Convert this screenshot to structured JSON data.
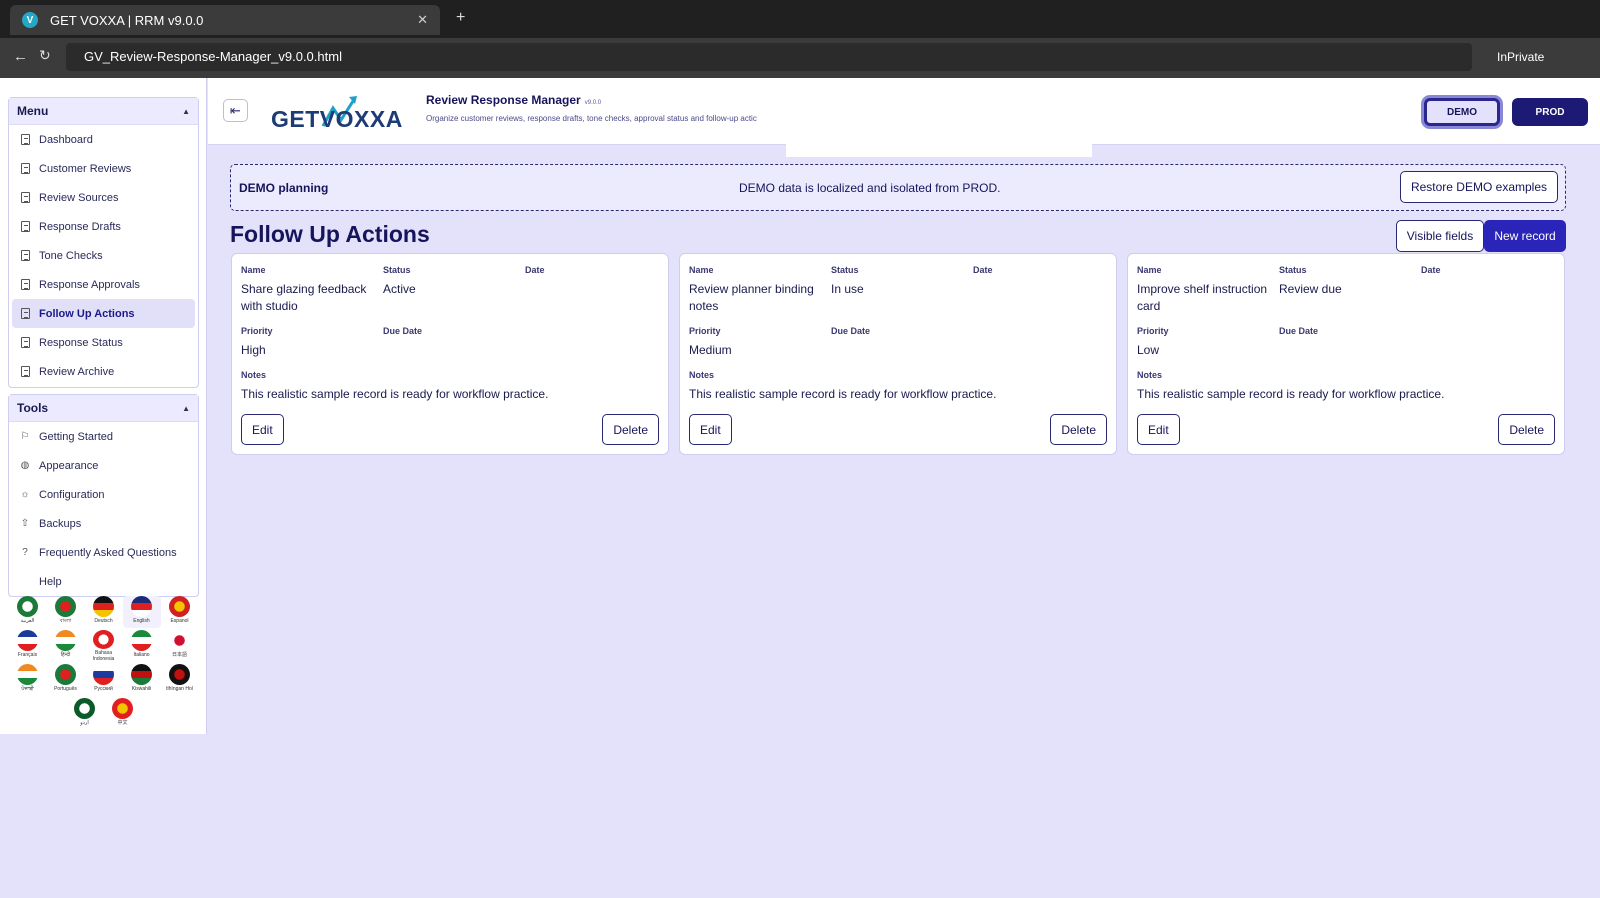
{
  "browser": {
    "tab_title": "GET VOXXA | RRM v9.0.0",
    "favicon_letter": "V",
    "url": "GV_Review-Response-Manager_v9.0.0.html",
    "inprivate": "InPrivate"
  },
  "sidebar": {
    "menu_title": "Menu",
    "menu_items": [
      {
        "label": "Dashboard"
      },
      {
        "label": "Customer Reviews"
      },
      {
        "label": "Review Sources"
      },
      {
        "label": "Response Drafts"
      },
      {
        "label": "Tone Checks"
      },
      {
        "label": "Response Approvals"
      },
      {
        "label": "Follow Up Actions",
        "active": true
      },
      {
        "label": "Response Status"
      },
      {
        "label": "Review Archive"
      }
    ],
    "tools_title": "Tools",
    "tools_items": [
      {
        "label": "Getting Started",
        "icon": "flag-icon"
      },
      {
        "label": "Appearance",
        "icon": "palette-icon"
      },
      {
        "label": "Configuration",
        "icon": "gear-icon"
      },
      {
        "label": "Backups",
        "icon": "upload-icon"
      },
      {
        "label": "Frequently Asked Questions",
        "icon": "question-icon"
      },
      {
        "label": "Help",
        "icon": ""
      }
    ],
    "languages": [
      {
        "name": "العربية",
        "colors": [
          "#1a7a3a",
          "#ffffff"
        ]
      },
      {
        "name": "বাংলা",
        "colors": [
          "#1a7a3a",
          "#e02020"
        ]
      },
      {
        "name": "Deutsch",
        "colors": [
          "#111111",
          "#e02020",
          "#f5c400"
        ]
      },
      {
        "name": "English",
        "colors": [
          "#1c2a78",
          "#e02020",
          "#ffffff"
        ],
        "selected": true
      },
      {
        "name": "Espanol",
        "colors": [
          "#d22020",
          "#f5c400"
        ]
      },
      {
        "name": "Français",
        "colors": [
          "#1c3a9a",
          "#ffffff",
          "#e02020"
        ]
      },
      {
        "name": "हिन्दी",
        "colors": [
          "#f08a20",
          "#ffffff",
          "#1a8a3a"
        ]
      },
      {
        "name": "Bahasa Indonesia",
        "colors": [
          "#e02020",
          "#ffffff"
        ]
      },
      {
        "name": "Italiano",
        "colors": [
          "#1a8a3a",
          "#ffffff",
          "#e02020"
        ]
      },
      {
        "name": "日本語",
        "colors": [
          "#ffffff",
          "#d01030"
        ]
      },
      {
        "name": "ਪੰਜਾਬੀ",
        "colors": [
          "#f08a20",
          "#ffffff",
          "#1a8a3a"
        ]
      },
      {
        "name": "Português",
        "colors": [
          "#1a7a3a",
          "#e02020"
        ]
      },
      {
        "name": "Русский",
        "colors": [
          "#ffffff",
          "#1c3aa0",
          "#e02020"
        ]
      },
      {
        "name": "Kiswahili",
        "colors": [
          "#111111",
          "#c01010",
          "#1a7a3a"
        ]
      },
      {
        "name": "tlhIngan Hol",
        "colors": [
          "#111111",
          "#c01010"
        ]
      },
      {
        "name": "اردو",
        "colors": [
          "#0a5a2a",
          "#ffffff"
        ]
      },
      {
        "name": "中文",
        "colors": [
          "#e02020",
          "#f5c400"
        ]
      }
    ]
  },
  "header": {
    "logo_text": "GETVOXXA",
    "app_title": "Review Response Manager",
    "app_version": "v9.0.0",
    "app_subtitle": "Organize customer reviews, response drafts, tone checks, approval status and follow-up actic",
    "demo_label": "DEMO",
    "prod_label": "PROD"
  },
  "banner": {
    "title": "DEMO planning",
    "message": "DEMO data is localized and isolated from PROD.",
    "restore_label": "Restore DEMO examples"
  },
  "section": {
    "title": "Follow Up Actions",
    "visible_fields_label": "Visible fields",
    "new_record_label": "New record"
  },
  "labels": {
    "name": "Name",
    "status": "Status",
    "date": "Date",
    "priority": "Priority",
    "due_date": "Due Date",
    "notes": "Notes",
    "edit": "Edit",
    "delete": "Delete"
  },
  "records": [
    {
      "name": "Share glazing feedback with studio",
      "status": "Active",
      "date": "",
      "priority": "High",
      "due_date": "",
      "notes": "This realistic sample record is ready for workflow practice."
    },
    {
      "name": "Review planner binding notes",
      "status": "In use",
      "date": "",
      "priority": "Medium",
      "due_date": "",
      "notes": "This realistic sample record is ready for workflow practice."
    },
    {
      "name": "Improve shelf instruction card",
      "status": "Review due",
      "date": "",
      "priority": "Low",
      "due_date": "",
      "notes": "This realistic sample record is ready for workflow practice."
    }
  ]
}
